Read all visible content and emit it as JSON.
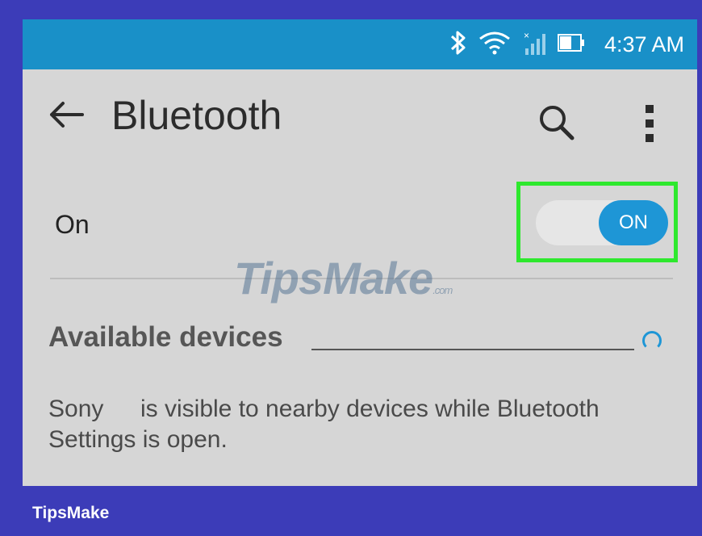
{
  "status_bar": {
    "time": "4:37 AM",
    "icons": [
      "bluetooth-icon",
      "wifi-icon",
      "signal-icon",
      "battery-icon"
    ],
    "color": "#1990c8"
  },
  "app_bar": {
    "title": "Bluetooth",
    "back_icon": "arrow-left-icon",
    "search_icon": "search-icon",
    "more_icon": "more-vertical-icon"
  },
  "bluetooth_toggle": {
    "label": "On",
    "state_label": "ON",
    "enabled": true,
    "accent": "#1e96d6",
    "highlight": "#2ee82e"
  },
  "watermark": {
    "text": "TipsMake",
    "suffix": ".com"
  },
  "available_devices": {
    "title": "Available devices",
    "spinner_icon": "loading-spinner-icon"
  },
  "visibility_note": {
    "device": "Sony",
    "text": "is visible to nearby devices while Bluetooth Settings is open."
  },
  "footer": {
    "brand": "TipsMake"
  }
}
